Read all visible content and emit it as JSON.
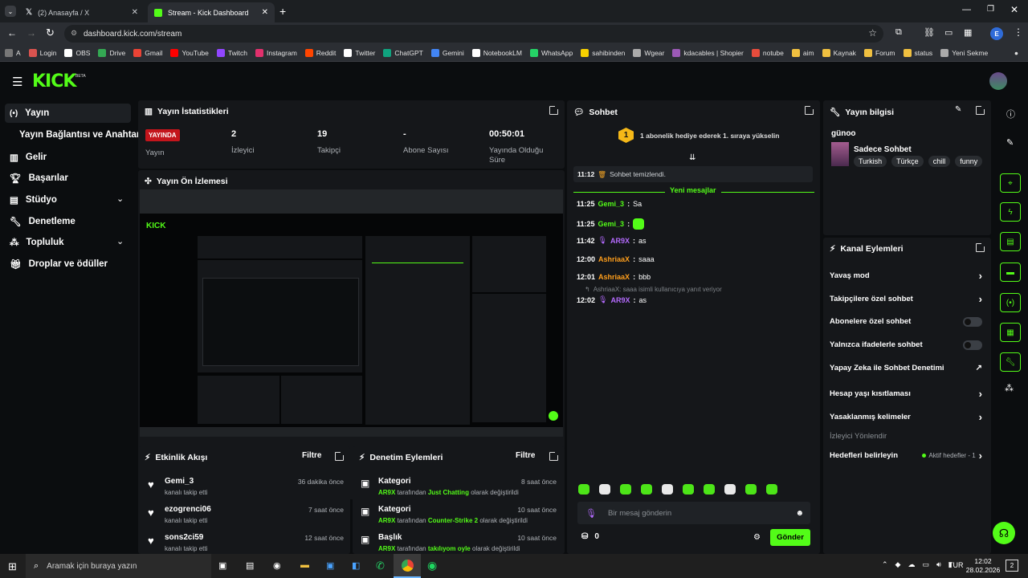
{
  "browser": {
    "tabs": [
      {
        "title": "(2) Anasayfa / X"
      },
      {
        "title": "Stream - Kick Dashboard"
      }
    ],
    "url": "dashboard.kick.com/stream",
    "profile_letter": "E",
    "bookmarks": [
      "A",
      "Login",
      "OBS",
      "Drive",
      "Gmail",
      "YouTube",
      "Twitch",
      "Instagram",
      "Reddit",
      "Twitter",
      "ChatGPT",
      "Gemini",
      "NotebookLM",
      "WhatsApp",
      "sahibinden",
      "Wgear",
      "kdacables | Shopier",
      "notube",
      "aim",
      "Kaynak",
      "Forum",
      "status",
      "Yeni Sekme"
    ]
  },
  "brand": {
    "logo": "KICK",
    "beta": "BETA",
    "accent": "#53fc18"
  },
  "sidebar": {
    "items": [
      {
        "label": "Yayın",
        "icon": "broadcast-icon"
      },
      {
        "label": "Yayın Bağlantısı ve Anahtarı"
      },
      {
        "label": "Gelir",
        "icon": "chart-icon"
      },
      {
        "label": "Başarılar",
        "icon": "trophy-icon"
      },
      {
        "label": "Stüdyo",
        "icon": "studio-icon"
      },
      {
        "label": "Denetleme",
        "icon": "wrench-icon"
      },
      {
        "label": "Topluluk",
        "icon": "community-icon"
      },
      {
        "label": "Droplar ve ödüller",
        "icon": "gift-icon"
      }
    ]
  },
  "stats": {
    "title": "Yayın İstatistikleri",
    "live_badge": "YAYINDA",
    "cols": [
      {
        "value": "",
        "label": "Yayın"
      },
      {
        "value": "2",
        "label": "İzleyici"
      },
      {
        "value": "19",
        "label": "Takipçi"
      },
      {
        "value": "-",
        "label": "Abone Sayısı"
      },
      {
        "value": "00:50:01",
        "label": "Yayında Olduğu Süre"
      }
    ]
  },
  "preview": {
    "title": "Yayın Ön İzlemesi"
  },
  "activity": {
    "title": "Etkinlik Akışı",
    "filter": "Filtre",
    "items": [
      {
        "user": "Gemi_3",
        "text": "kanalı takip etti",
        "time": "36 dakika önce"
      },
      {
        "user": "ezogrenci06",
        "text": "kanalı takip etti",
        "time": "7 saat önce"
      },
      {
        "user": "sons2ci59",
        "text": "kanalı takip etti",
        "time": "12 saat önce"
      }
    ]
  },
  "moderation": {
    "title": "Denetim Eylemleri",
    "filter": "Filtre",
    "items": [
      {
        "title": "Kategori",
        "user": "AR9X",
        "mid": "tarafından",
        "target": "Just Chatting",
        "suffix": "olarak değiştirildi",
        "time": "8 saat önce"
      },
      {
        "title": "Kategori",
        "user": "AR9X",
        "mid": "tarafından",
        "target": "Counter-Strike 2",
        "suffix": "olarak değiştirildi",
        "time": "10 saat önce"
      },
      {
        "title": "Başlık",
        "user": "AR9X",
        "mid": "tarafından",
        "target": "takılıyom oyle",
        "suffix": "olarak değiştirildi",
        "time": "10 saat önce"
      }
    ]
  },
  "chat": {
    "title": "Sohbet",
    "gift_count": "1",
    "gift_text": "1 abonelik hediye ederek 1. sıraya yükselin",
    "system_time": "11:12",
    "system_text": "Sohbet temizlendi.",
    "new_messages": "Yeni mesajlar",
    "messages": [
      {
        "time": "11:25",
        "user": "Gemi_3",
        "text": "Sa"
      },
      {
        "time": "11:25",
        "user": "Gemi_3",
        "text": ""
      },
      {
        "time": "11:42",
        "user": "AR9X",
        "text": "as"
      },
      {
        "time": "12:00",
        "user": "AshriaaX",
        "text": "saaa"
      },
      {
        "time": "12:01",
        "user": "AshriaaX",
        "text": "bbb"
      }
    ],
    "reply_note": "AshriaaX: saaa isimli kullanıcıya yanıt veriyor",
    "last_msg": {
      "time": "12:02",
      "user": "AR9X",
      "text": "as"
    },
    "placeholder": "Bir mesaj gönderin",
    "points": "0",
    "send": "Gönder",
    "colors": {
      "gemi": "#53fc18",
      "ar9x": "#b56bff",
      "ashriaax": "#ff9f1c"
    }
  },
  "info": {
    "title": "Yayın bilgisi",
    "stream_title": "günoo",
    "category": "Sadece Sohbet",
    "tags": [
      "Turkish",
      "Türkçe",
      "chill",
      "funny"
    ]
  },
  "channel_actions": {
    "title": "Kanal Eylemleri",
    "items": [
      {
        "label": "Yavaş mod",
        "control": "chevron"
      },
      {
        "label": "Takipçilere özel sohbet",
        "control": "chevron"
      },
      {
        "label": "Abonelere özel sohbet",
        "control": "toggle"
      },
      {
        "label": "Yalnızca ifadelerle sohbet",
        "control": "toggle"
      },
      {
        "label": "Yapay Zeka ile Sohbet Denetimi",
        "control": "external"
      },
      {
        "label": "Hesap yaşı kısıtlaması",
        "control": "chevron"
      },
      {
        "label": "Yasaklanmış kelimeler",
        "control": "chevron"
      }
    ],
    "raid": "İzleyici Yönlendir",
    "goals": "Hedefleri belirleyin",
    "goals_status": "Aktif hedefler - 1"
  },
  "taskbar": {
    "search_placeholder": "Aramak için buraya yazın",
    "lang": "TUR",
    "time": "12:02",
    "date": "28.02.2026",
    "notif_count": "2"
  }
}
